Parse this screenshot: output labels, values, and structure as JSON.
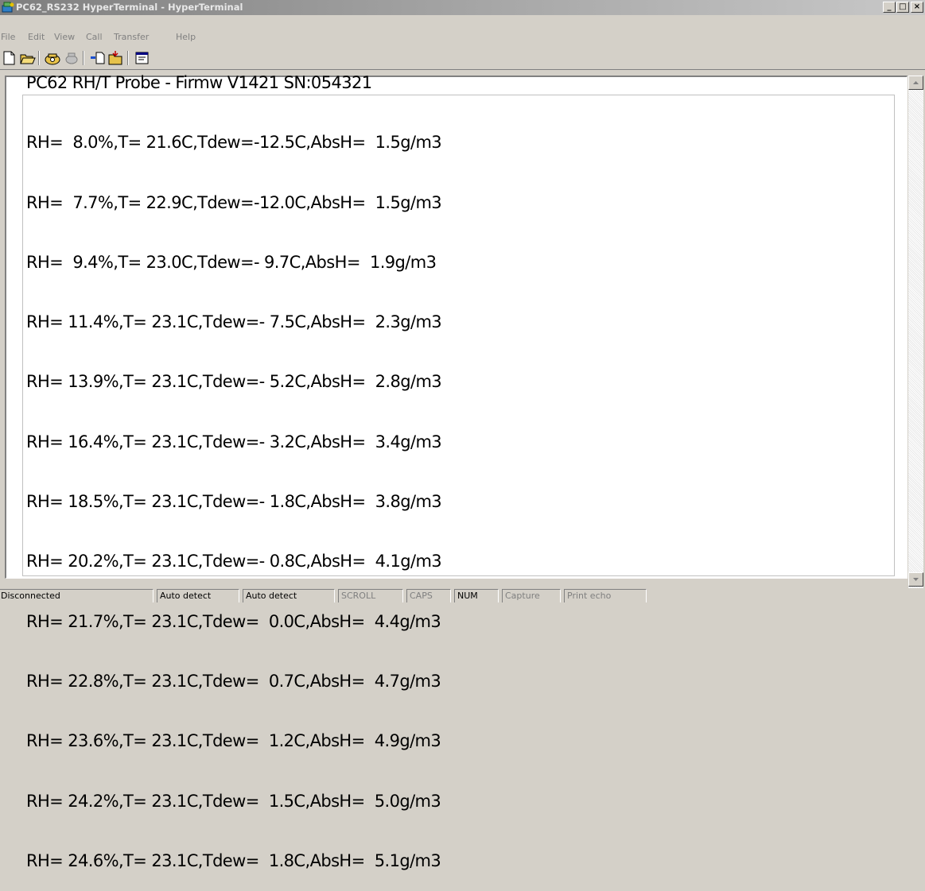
{
  "window": {
    "title": "PC62_RS232 HyperTerminal - HyperTerminal",
    "minimize_glyph": "_",
    "maximize_glyph": "□",
    "close_glyph": "×"
  },
  "menu": [
    "File",
    "Edit",
    "View",
    "Call",
    "Transfer",
    "Help"
  ],
  "toolbar": {
    "buttons": [
      "new-icon",
      "open-icon",
      "connect-icon",
      "disconnect-icon",
      "send-icon",
      "receive-icon",
      "properties-icon"
    ]
  },
  "terminal": {
    "lines": [
      "PC62 RH/T Probe - Firmw V1421 SN:054321",
      "RH=  8.0%,T= 21.6C,Tdew=-12.5C,AbsH=  1.5g/m3",
      "RH=  7.7%,T= 22.9C,Tdew=-12.0C,AbsH=  1.5g/m3",
      "RH=  9.4%,T= 23.0C,Tdew=- 9.7C,AbsH=  1.9g/m3",
      "RH= 11.4%,T= 23.1C,Tdew=- 7.5C,AbsH=  2.3g/m3",
      "RH= 13.9%,T= 23.1C,Tdew=- 5.2C,AbsH=  2.8g/m3",
      "RH= 16.4%,T= 23.1C,Tdew=- 3.2C,AbsH=  3.4g/m3",
      "RH= 18.5%,T= 23.1C,Tdew=- 1.8C,AbsH=  3.8g/m3",
      "RH= 20.2%,T= 23.1C,Tdew=- 0.8C,AbsH=  4.1g/m3",
      "RH= 21.7%,T= 23.1C,Tdew=  0.0C,AbsH=  4.4g/m3",
      "RH= 22.8%,T= 23.1C,Tdew=  0.7C,AbsH=  4.7g/m3",
      "RH= 23.6%,T= 23.1C,Tdew=  1.2C,AbsH=  4.9g/m3",
      "RH= 24.2%,T= 23.1C,Tdew=  1.5C,AbsH=  5.0g/m3",
      "RH= 24.6%,T= 23.1C,Tdew=  1.8C,AbsH=  5.1g/m3"
    ]
  },
  "status": {
    "connection": "Disconnected",
    "emulation": "Auto detect",
    "settings": "Auto detect",
    "scroll": "SCROLL",
    "caps": "CAPS",
    "num": "NUM",
    "capture": "Capture",
    "print_echo": "Print echo"
  },
  "colors": {
    "window_face": "#d4d0c8",
    "terminal_bg": "#ffffff",
    "disabled_text": "#808080"
  }
}
